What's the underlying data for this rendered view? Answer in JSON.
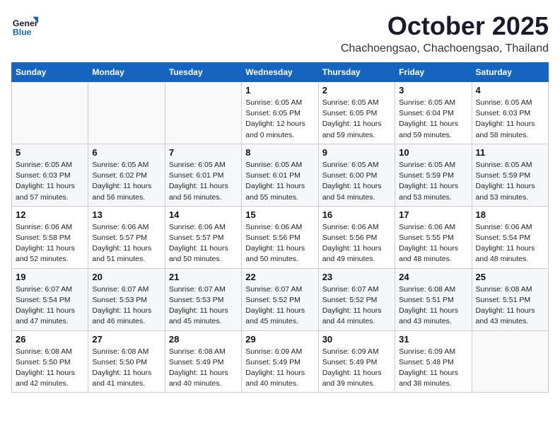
{
  "header": {
    "logo_general": "General",
    "logo_blue": "Blue",
    "month": "October 2025",
    "location": "Chachoengsao, Chachoengsao, Thailand"
  },
  "weekdays": [
    "Sunday",
    "Monday",
    "Tuesday",
    "Wednesday",
    "Thursday",
    "Friday",
    "Saturday"
  ],
  "weeks": [
    [
      {
        "day": "",
        "info": ""
      },
      {
        "day": "",
        "info": ""
      },
      {
        "day": "",
        "info": ""
      },
      {
        "day": "1",
        "info": "Sunrise: 6:05 AM\nSunset: 6:05 PM\nDaylight: 12 hours\nand 0 minutes."
      },
      {
        "day": "2",
        "info": "Sunrise: 6:05 AM\nSunset: 6:05 PM\nDaylight: 11 hours\nand 59 minutes."
      },
      {
        "day": "3",
        "info": "Sunrise: 6:05 AM\nSunset: 6:04 PM\nDaylight: 11 hours\nand 59 minutes."
      },
      {
        "day": "4",
        "info": "Sunrise: 6:05 AM\nSunset: 6:03 PM\nDaylight: 11 hours\nand 58 minutes."
      }
    ],
    [
      {
        "day": "5",
        "info": "Sunrise: 6:05 AM\nSunset: 6:03 PM\nDaylight: 11 hours\nand 57 minutes."
      },
      {
        "day": "6",
        "info": "Sunrise: 6:05 AM\nSunset: 6:02 PM\nDaylight: 11 hours\nand 56 minutes."
      },
      {
        "day": "7",
        "info": "Sunrise: 6:05 AM\nSunset: 6:01 PM\nDaylight: 11 hours\nand 56 minutes."
      },
      {
        "day": "8",
        "info": "Sunrise: 6:05 AM\nSunset: 6:01 PM\nDaylight: 11 hours\nand 55 minutes."
      },
      {
        "day": "9",
        "info": "Sunrise: 6:05 AM\nSunset: 6:00 PM\nDaylight: 11 hours\nand 54 minutes."
      },
      {
        "day": "10",
        "info": "Sunrise: 6:05 AM\nSunset: 5:59 PM\nDaylight: 11 hours\nand 53 minutes."
      },
      {
        "day": "11",
        "info": "Sunrise: 6:05 AM\nSunset: 5:59 PM\nDaylight: 11 hours\nand 53 minutes."
      }
    ],
    [
      {
        "day": "12",
        "info": "Sunrise: 6:06 AM\nSunset: 5:58 PM\nDaylight: 11 hours\nand 52 minutes."
      },
      {
        "day": "13",
        "info": "Sunrise: 6:06 AM\nSunset: 5:57 PM\nDaylight: 11 hours\nand 51 minutes."
      },
      {
        "day": "14",
        "info": "Sunrise: 6:06 AM\nSunset: 5:57 PM\nDaylight: 11 hours\nand 50 minutes."
      },
      {
        "day": "15",
        "info": "Sunrise: 6:06 AM\nSunset: 5:56 PM\nDaylight: 11 hours\nand 50 minutes."
      },
      {
        "day": "16",
        "info": "Sunrise: 6:06 AM\nSunset: 5:56 PM\nDaylight: 11 hours\nand 49 minutes."
      },
      {
        "day": "17",
        "info": "Sunrise: 6:06 AM\nSunset: 5:55 PM\nDaylight: 11 hours\nand 48 minutes."
      },
      {
        "day": "18",
        "info": "Sunrise: 6:06 AM\nSunset: 5:54 PM\nDaylight: 11 hours\nand 48 minutes."
      }
    ],
    [
      {
        "day": "19",
        "info": "Sunrise: 6:07 AM\nSunset: 5:54 PM\nDaylight: 11 hours\nand 47 minutes."
      },
      {
        "day": "20",
        "info": "Sunrise: 6:07 AM\nSunset: 5:53 PM\nDaylight: 11 hours\nand 46 minutes."
      },
      {
        "day": "21",
        "info": "Sunrise: 6:07 AM\nSunset: 5:53 PM\nDaylight: 11 hours\nand 45 minutes."
      },
      {
        "day": "22",
        "info": "Sunrise: 6:07 AM\nSunset: 5:52 PM\nDaylight: 11 hours\nand 45 minutes."
      },
      {
        "day": "23",
        "info": "Sunrise: 6:07 AM\nSunset: 5:52 PM\nDaylight: 11 hours\nand 44 minutes."
      },
      {
        "day": "24",
        "info": "Sunrise: 6:08 AM\nSunset: 5:51 PM\nDaylight: 11 hours\nand 43 minutes."
      },
      {
        "day": "25",
        "info": "Sunrise: 6:08 AM\nSunset: 5:51 PM\nDaylight: 11 hours\nand 43 minutes."
      }
    ],
    [
      {
        "day": "26",
        "info": "Sunrise: 6:08 AM\nSunset: 5:50 PM\nDaylight: 11 hours\nand 42 minutes."
      },
      {
        "day": "27",
        "info": "Sunrise: 6:08 AM\nSunset: 5:50 PM\nDaylight: 11 hours\nand 41 minutes."
      },
      {
        "day": "28",
        "info": "Sunrise: 6:08 AM\nSunset: 5:49 PM\nDaylight: 11 hours\nand 40 minutes."
      },
      {
        "day": "29",
        "info": "Sunrise: 6:09 AM\nSunset: 5:49 PM\nDaylight: 11 hours\nand 40 minutes."
      },
      {
        "day": "30",
        "info": "Sunrise: 6:09 AM\nSunset: 5:49 PM\nDaylight: 11 hours\nand 39 minutes."
      },
      {
        "day": "31",
        "info": "Sunrise: 6:09 AM\nSunset: 5:48 PM\nDaylight: 11 hours\nand 38 minutes."
      },
      {
        "day": "",
        "info": ""
      }
    ]
  ]
}
